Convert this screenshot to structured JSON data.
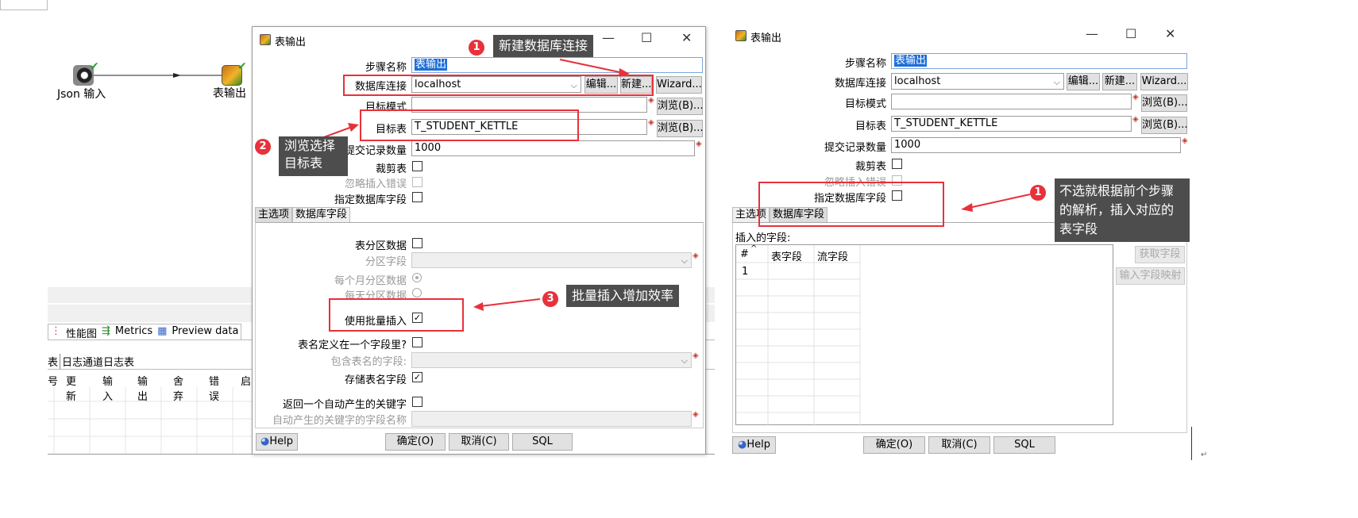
{
  "canvas": {
    "step_json": "Json 输入",
    "step_output": "表输出"
  },
  "bottom_panel": {
    "tabs": [
      "性能图",
      "Metrics",
      "Preview data"
    ],
    "log_tabs": [
      "表",
      "日志通道日志表"
    ],
    "columns": [
      "号",
      "更新",
      "输入",
      "输出",
      "舍弃",
      "错误",
      "启"
    ]
  },
  "dialog1": {
    "title": "表输出",
    "step_name_label": "步骤名称",
    "step_name_value": "表输出",
    "db_conn_label": "数据库连接",
    "db_conn_value": "localhost",
    "edit_btn": "编辑...",
    "new_btn": "新建...",
    "wizard_btn": "Wizard...",
    "target_schema_label": "目标模式",
    "browse_btn": "浏览(B)...",
    "target_table_label": "目标表",
    "target_table_value": "T_STUDENT_KETTLE",
    "commit_label": "提交记录数量",
    "commit_value": "1000",
    "truncate_label": "裁剪表",
    "ignore_label": "忽略插入错误",
    "specify_label": "指定数据库字段",
    "tab_main": "主选项",
    "tab_fields": "数据库字段",
    "partition_label": "表分区数据",
    "partition_field_label": "分区字段",
    "monthly_label": "每个月分区数据",
    "daily_label": "每天分区数据",
    "batch_label": "使用批量插入",
    "tablename_in_field_label": "表名定义在一个字段里?",
    "tablename_field_label": "包含表名的字段:",
    "store_tablename_label": "存储表名字段",
    "return_key_label": "返回一个自动产生的关键字",
    "key_field_label": "自动产生的关键字的字段名称",
    "help_btn": "Help",
    "ok_btn": "确定(O)",
    "cancel_btn": "取消(C)",
    "sql_btn": "SQL"
  },
  "dialog2": {
    "title": "表输出",
    "step_name_label": "步骤名称",
    "step_name_value": "表输出",
    "db_conn_label": "数据库连接",
    "db_conn_value": "localhost",
    "edit_btn": "编辑...",
    "new_btn": "新建...",
    "wizard_btn": "Wizard...",
    "target_schema_label": "目标模式",
    "browse_btn": "浏览(B)...",
    "target_table_label": "目标表",
    "target_table_value": "T_STUDENT_KETTLE",
    "commit_label": "提交记录数量",
    "commit_value": "1000",
    "truncate_label": "裁剪表",
    "ignore_label": "忽略插入错误",
    "specify_label": "指定数据库字段",
    "tab_main": "主选项",
    "tab_fields": "数据库字段",
    "insert_fields_label": "插入的字段:",
    "col_num": "#",
    "col_table_field": "表字段",
    "col_stream_field": "流字段",
    "row1": "1",
    "get_fields_btn": "获取字段",
    "map_btn": "输入字段映射",
    "help_btn": "Help",
    "ok_btn": "确定(O)",
    "cancel_btn": "取消(C)",
    "sql_btn": "SQL"
  },
  "annotations": {
    "a1_num": "1",
    "a1_text": "新建数据库连接",
    "a2_num": "2",
    "a2_line1": "浏览选择",
    "a2_line2": "目标表",
    "a3_num": "3",
    "a3_text": "批量插入增加效率",
    "b1_num": "1",
    "b1_line1": "不选就根据前个步骤",
    "b1_line2": "的解析，插入对应的",
    "b1_line3": "表字段"
  },
  "colors": {
    "accent_red": "#e8313b",
    "callout_bg": "#4d4d4d",
    "selection": "#1e6ed8"
  }
}
